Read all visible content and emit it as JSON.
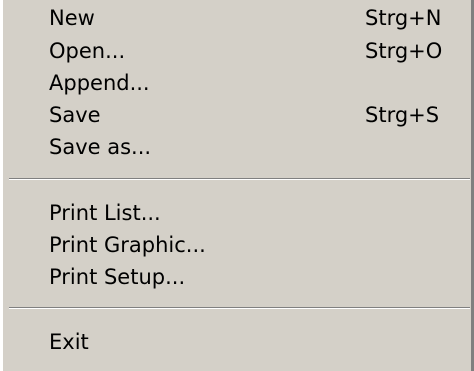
{
  "menu": {
    "items": [
      {
        "label": "New",
        "shortcut": "Strg+N"
      },
      {
        "label": "Open...",
        "shortcut": "Strg+O"
      },
      {
        "label": "Append...",
        "shortcut": ""
      },
      {
        "label": "Save",
        "shortcut": "Strg+S"
      },
      {
        "label": "Save as...",
        "shortcut": ""
      },
      {
        "label": "Print List...",
        "shortcut": ""
      },
      {
        "label": "Print Graphic...",
        "shortcut": ""
      },
      {
        "label": "Print Setup...",
        "shortcut": ""
      },
      {
        "label": "Exit",
        "shortcut": ""
      }
    ]
  }
}
